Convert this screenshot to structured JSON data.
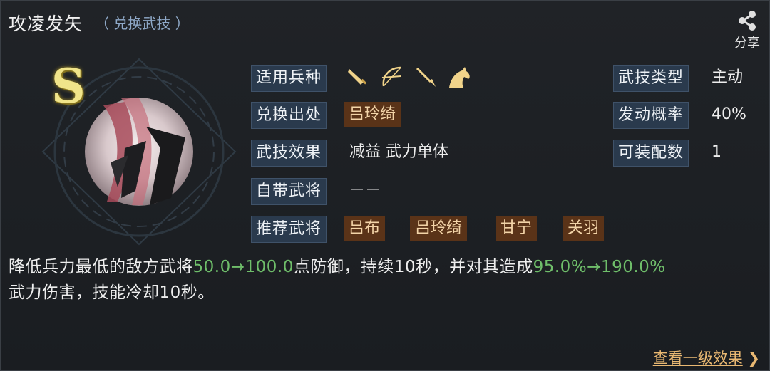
{
  "header": {
    "title": "攻凌发矢",
    "subtitle": "（ 兑换武技 ）",
    "share_label": "分享"
  },
  "skill": {
    "grade": "S"
  },
  "left_rows": [
    {
      "label": "适用兵种",
      "icons": [
        "saber-icon",
        "bow-icon",
        "spear-icon",
        "horse-icon"
      ]
    },
    {
      "label": "兑换出处",
      "tags": [
        "吕玲绮"
      ]
    },
    {
      "label": "武技效果",
      "text": "减益 武力单体"
    },
    {
      "label": "自带武将",
      "text": "－－"
    },
    {
      "label": "推荐武将",
      "tags": [
        "吕布",
        "吕玲绮",
        "甘宁",
        "关羽"
      ]
    }
  ],
  "right_rows": [
    {
      "label": "武技类型",
      "value": "主动"
    },
    {
      "label": "发动概率",
      "value": "40%"
    },
    {
      "label": "可装配数",
      "value": "1"
    }
  ],
  "description": {
    "part1": "降低兵力最低的敌方武将",
    "green1": "50.0→100.0",
    "part2": "点防御，持续10秒，并对其造成",
    "green2": "95.0%→190.0%",
    "part3": "武力伤害，技能冷却10秒。"
  },
  "footer": {
    "more_label": "查看一级效果",
    "more_arrow": "❯"
  },
  "colors": {
    "label_bg": "#2a3a4d",
    "tag_bg": "#5a3318",
    "tag_text": "#f3d4a8",
    "highlight_green": "#6fbe6a",
    "link_gold": "#e9b872",
    "grade_gold": "#f0e48a"
  }
}
